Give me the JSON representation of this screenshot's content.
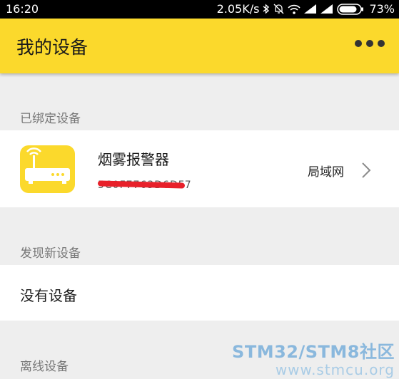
{
  "status_bar": {
    "time": "16:20",
    "network_speed": "2.05K/s",
    "battery_percent": "73%",
    "icons": [
      "bluetooth-icon",
      "mute-bell-icon",
      "wifi-icon",
      "signal-icon",
      "signal-icon",
      "battery-icon"
    ]
  },
  "app_bar": {
    "title": "我的设备",
    "menu_icon": "more-dots-icon"
  },
  "sections": {
    "bound": {
      "label": "已绑定设备",
      "devices": [
        {
          "name": "烟雾报警器",
          "device_id": "5C0F7763D6DF74",
          "network": "局域网",
          "icon": "router-wifi-icon",
          "icon_color": "#fbd92c"
        }
      ]
    },
    "discover": {
      "label": "发现新设备",
      "empty_text": "没有设备"
    },
    "offline": {
      "label": "离线设备"
    }
  },
  "watermark": {
    "title": "STM32/STM8社区",
    "url": "www.stmcu.org"
  },
  "colors": {
    "accent": "#fbd92c",
    "background": "#eeeeee",
    "redaction": "#e8202a"
  }
}
